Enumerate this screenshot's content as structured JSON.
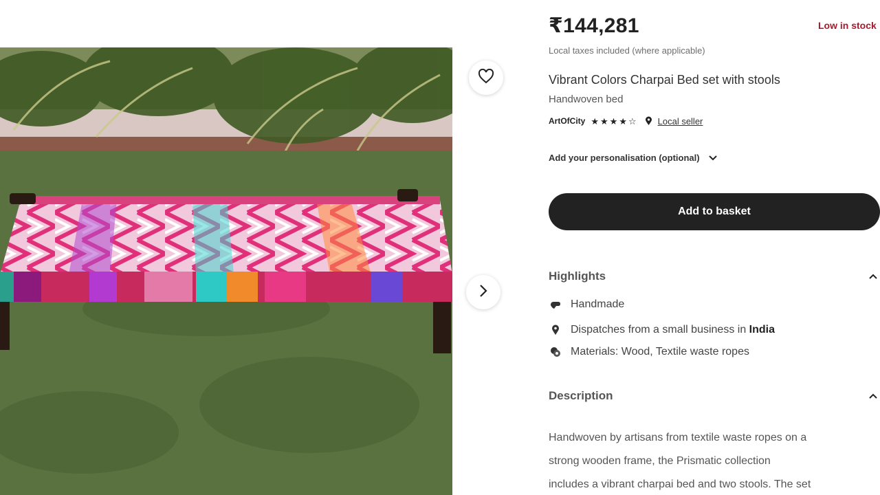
{
  "product": {
    "price": "₹144,281",
    "stock_status": "Low in stock",
    "tax_note": "Local taxes included (where applicable)",
    "title": "Vibrant Colors Charpai Bed set with stools",
    "subtitle": "Handwoven bed",
    "seller": "ArtOfCity",
    "rating": 4,
    "rating_max": 5,
    "local_seller_label": "Local seller"
  },
  "personalisation_label": "Add your personalisation (optional)",
  "add_to_basket_label": "Add to basket",
  "highlights": {
    "heading": "Highlights",
    "items": [
      {
        "icon": "hand-icon",
        "text": "Handmade"
      },
      {
        "icon": "location-pin-icon",
        "text_prefix": "Dispatches from a small business in",
        "text_bold": "India"
      },
      {
        "icon": "materials-icon",
        "text": "Materials: Wood, Textile waste ropes"
      }
    ]
  },
  "description": {
    "heading": "Description",
    "lines": [
      "Handwoven by artisans from textile waste ropes on a",
      "strong wooden frame, the Prismatic collection",
      "includes a vibrant charpai bed and two stools. The set"
    ]
  },
  "colors": {
    "button_bg": "#222222",
    "stock_red": "#a61a2e",
    "muted_text": "#6e6e6e"
  }
}
